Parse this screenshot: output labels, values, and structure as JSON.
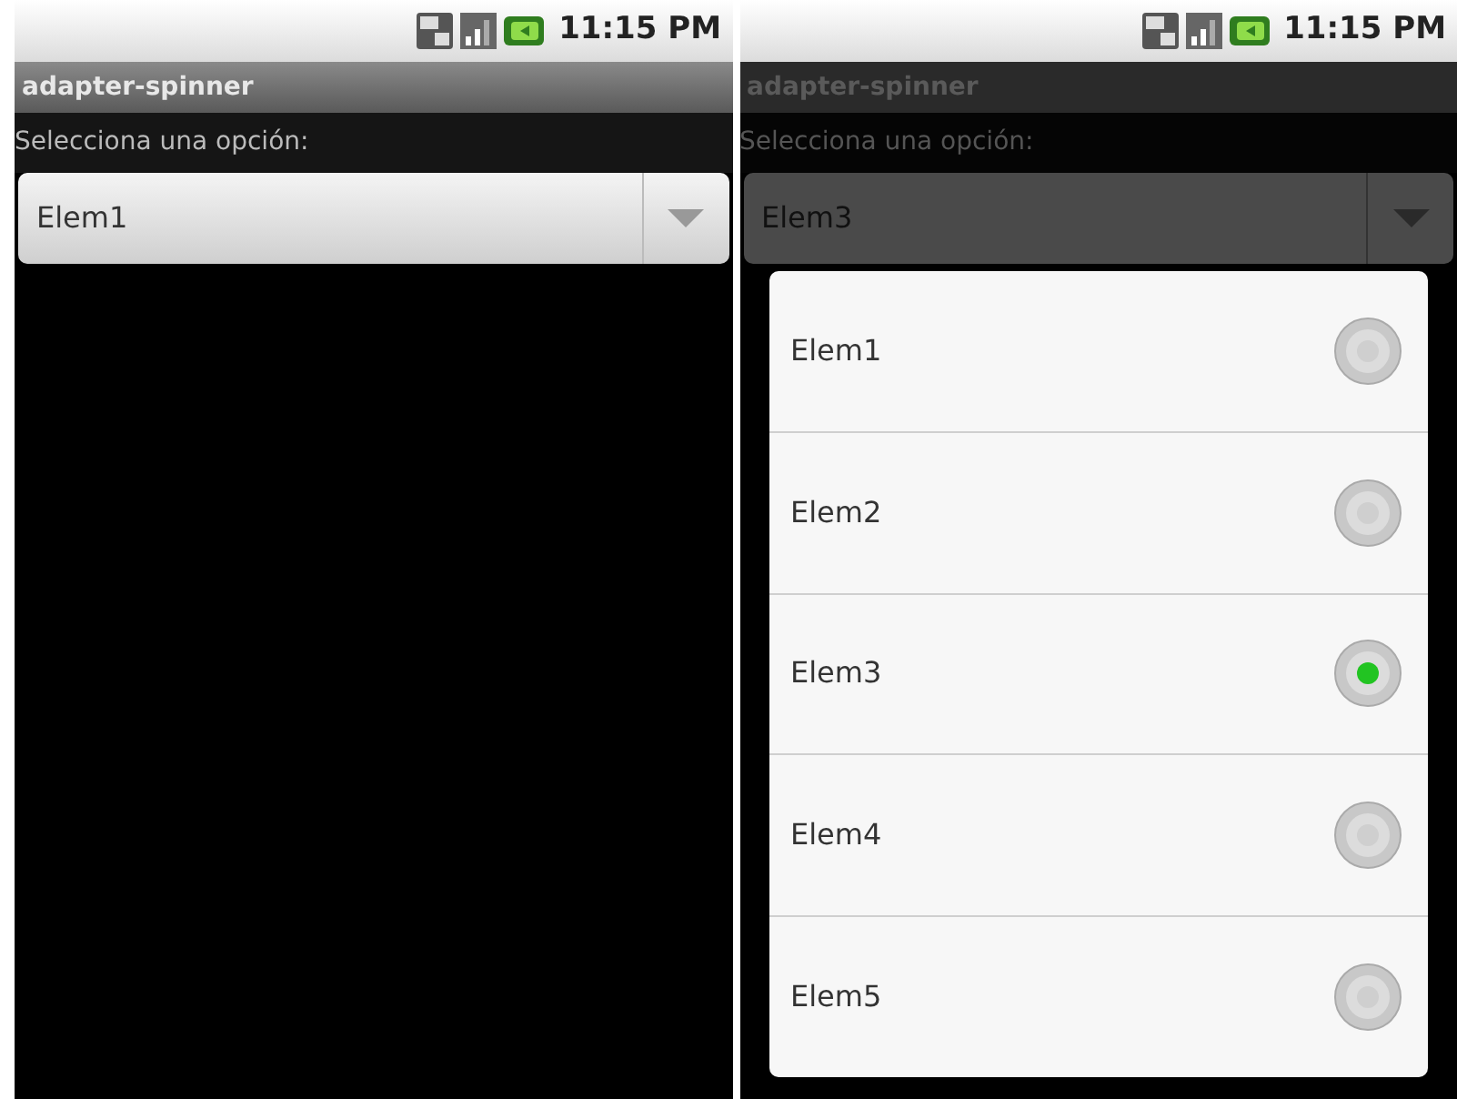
{
  "screens": [
    {
      "status_time": "11:15 PM",
      "title": "adapter-spinner",
      "prompt": "Selecciona una opción:",
      "spinner_value": "Elem1",
      "dimmed": false
    },
    {
      "status_time": "11:15 PM",
      "title": "adapter-spinner",
      "prompt": "Selecciona una opción:",
      "spinner_value": "Elem3",
      "dimmed": true,
      "dialog": {
        "options": [
          {
            "label": "Elem1",
            "selected": false
          },
          {
            "label": "Elem2",
            "selected": false
          },
          {
            "label": "Elem3",
            "selected": true
          },
          {
            "label": "Elem4",
            "selected": false
          },
          {
            "label": "Elem5",
            "selected": false
          }
        ]
      }
    }
  ]
}
